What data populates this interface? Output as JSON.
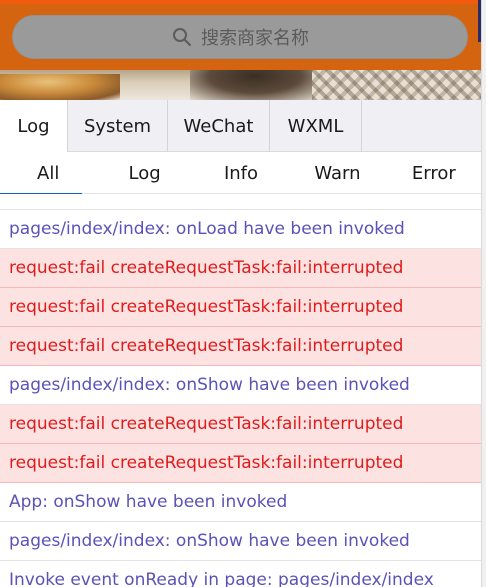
{
  "header": {
    "search_placeholder": "搜索商家名称",
    "search_icon": "search-icon"
  },
  "tabs": [
    {
      "label": "Log",
      "active": true
    },
    {
      "label": "System",
      "active": false
    },
    {
      "label": "WeChat",
      "active": false
    },
    {
      "label": "WXML",
      "active": false
    }
  ],
  "filters": [
    {
      "label": "All",
      "active": true
    },
    {
      "label": "Log",
      "active": false
    },
    {
      "label": "Info",
      "active": false
    },
    {
      "label": "Warn",
      "active": false
    },
    {
      "label": "Error",
      "active": false
    }
  ],
  "logs": [
    {
      "level": "info",
      "text": "pages/index/index: onLoad have been invoked"
    },
    {
      "level": "error",
      "text": "request:fail createRequestTask:fail:interrupted"
    },
    {
      "level": "error",
      "text": "request:fail createRequestTask:fail:interrupted"
    },
    {
      "level": "error",
      "text": "request:fail createRequestTask:fail:interrupted"
    },
    {
      "level": "info",
      "text": "pages/index/index: onShow have been invoked"
    },
    {
      "level": "error",
      "text": "request:fail createRequestTask:fail:interrupted"
    },
    {
      "level": "error",
      "text": "request:fail createRequestTask:fail:interrupted"
    },
    {
      "level": "info",
      "text": "App: onShow have been invoked"
    },
    {
      "level": "info",
      "text": "pages/index/index: onShow have been invoked"
    },
    {
      "level": "info",
      "text": "Invoke event onReady in page: pages/index/index"
    }
  ],
  "colors": {
    "info_text": "#5b52b8",
    "error_text": "#e01b1b",
    "error_bg": "#fde2e2",
    "active_underline": "#1565c0",
    "header_bg": "#d4640f"
  }
}
